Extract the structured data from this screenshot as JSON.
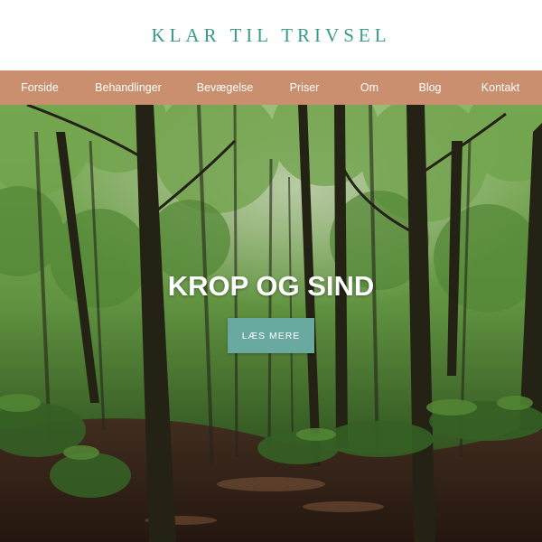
{
  "header": {
    "site_title": "KLAR TIL TRIVSEL"
  },
  "nav": {
    "items": [
      {
        "label": "Forside"
      },
      {
        "label": "Behandlinger"
      },
      {
        "label": "Bevægelse"
      },
      {
        "label": "Priser"
      },
      {
        "label": "Om"
      },
      {
        "label": "Blog"
      },
      {
        "label": "Kontakt"
      }
    ]
  },
  "hero": {
    "title": "KROP OG SIND",
    "button_label": "LÆS MERE"
  },
  "colors": {
    "brand_teal": "#3a9a8c",
    "nav_background": "#c98f6e",
    "button_background": "#6aa9a0"
  }
}
